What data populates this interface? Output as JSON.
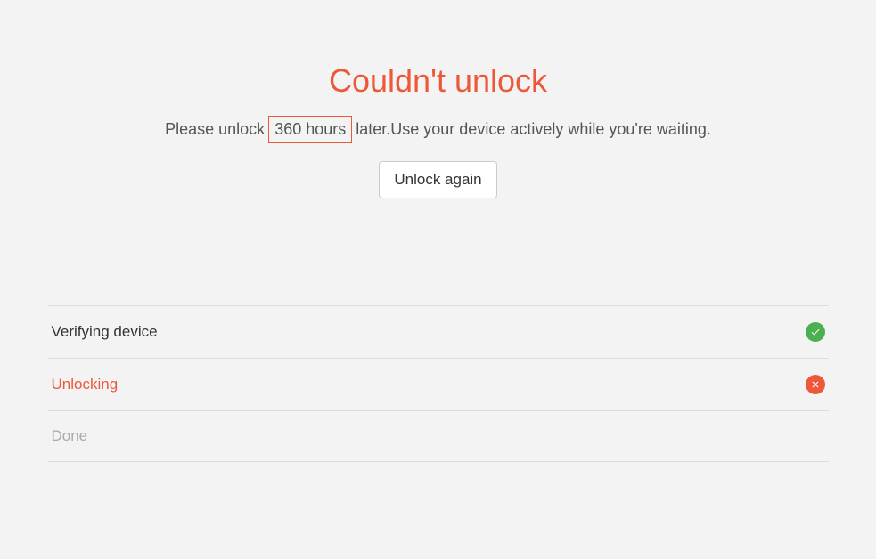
{
  "header": {
    "title": "Couldn't unlock",
    "subtitle_prefix": "Please unlock",
    "highlight": "360 hours",
    "subtitle_suffix": "later.Use your device actively while you're waiting.",
    "button_label": "Unlock again"
  },
  "steps": [
    {
      "label": "Verifying device",
      "status": "complete"
    },
    {
      "label": "Unlocking",
      "status": "error"
    },
    {
      "label": "Done",
      "status": "pending"
    }
  ]
}
